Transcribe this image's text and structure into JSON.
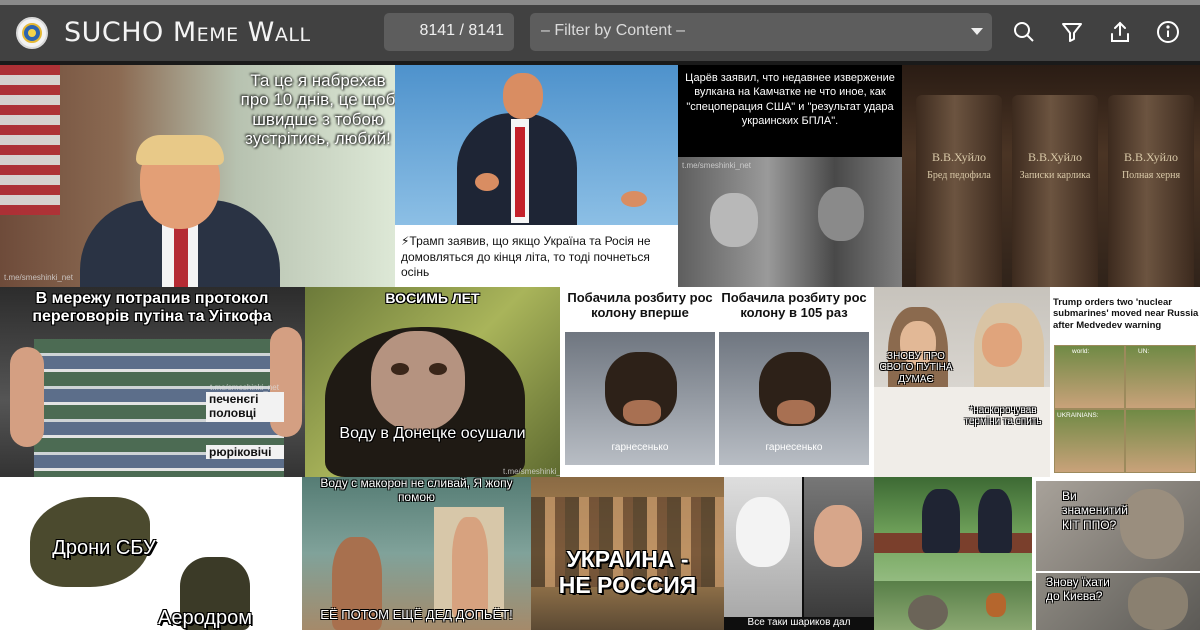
{
  "header": {
    "title": "SUCHO Meme Wall",
    "counter": "8141 / 8141",
    "filter_placeholder": "– Filter by Content –",
    "icons": [
      "search-icon",
      "filter-icon",
      "upload-icon",
      "info-icon"
    ],
    "colors": {
      "bar": "#414141",
      "control": "#5d5d5d",
      "strip": "#8a8a8a"
    }
  },
  "memes": [
    {
      "name": "trump-phone",
      "captions": [
        "Та це я набрехав про 10 днів, це щоб швидше з тобою зустрітись, любий!"
      ],
      "watermark": "t.me/smeshinki_net"
    },
    {
      "name": "trump-autumn",
      "captions": [
        "⚡Трамп заявив, що якщо Україна та Росія не домовляться до кінця літа, то тоді почнеться осінь"
      ]
    },
    {
      "name": "tsaryov-volcano",
      "captions": [
        "Царёв заявил, что недавнее извержение вулкана на Камчатке не что иное, как \"спецоперация США\" и \"результат удара украинских БПЛА\"."
      ],
      "watermark": "t.me/smeshinki_net"
    },
    {
      "name": "huilo-books",
      "books": [
        {
          "title": "В.В.Хуйло",
          "subtitle": "Бред педофила"
        },
        {
          "title": "В.В.Хуйло",
          "subtitle": "Записки карлика"
        },
        {
          "title": "В.В.Хуйло",
          "subtitle": "Полная херня"
        }
      ]
    },
    {
      "name": "history-books",
      "captions": [
        "В мережу потрапив протокол переговорів путіна та Уіткофа",
        "печенєгі половці",
        "рюріковічі"
      ],
      "watermark": "t.me/smeshinki_net"
    },
    {
      "name": "chimp-donetsk",
      "captions": [
        "ВОСИМЬ ЛЕТ",
        "Воду в Донецке осушали"
      ],
      "watermark": "t.me/smeshinki_net"
    },
    {
      "name": "dog-convoy",
      "captions": [
        "Побачила розбиту рос колону вперше",
        "Побачила розбиту рос колону в 105 раз"
      ],
      "labels": [
        "гарнесенько",
        "гарнесенько"
      ]
    },
    {
      "name": "melania-trump-bed",
      "captions": [
        "ЗНОВУ ПРО СВОГО ПУТІНА ДУМАЄ",
        "*наскорочував терміни та спить"
      ]
    },
    {
      "name": "trump-submarines",
      "captions": [
        "Trump orders two 'nuclear submarines' moved near Russia after Medvedev warning"
      ],
      "labels": [
        "world:",
        "UN:",
        "UKRAINIANS:"
      ]
    },
    {
      "name": "sbu-drones",
      "captions": [
        "Дрони СБУ",
        "Аеродром"
      ]
    },
    {
      "name": "makaron-dad",
      "captions": [
        "Воду с макорон не сливай, Я жопу помою",
        "ЕЁ ПОТОМ ЕЩЁ ДЕД ДОПЬЁТ!"
      ]
    },
    {
      "name": "ukraine-not-russia",
      "captions": [
        "УКРАИНА -",
        "НЕ РОССИЯ"
      ]
    },
    {
      "name": "sharikov",
      "captions": [
        "Все таки шариков дал"
      ]
    },
    {
      "name": "bench-meeting",
      "captions": []
    },
    {
      "name": "cat-ppo",
      "captions": [
        "Ви знаменитий КІТ ППО?",
        "Знову їхати до Києва?"
      ]
    }
  ]
}
